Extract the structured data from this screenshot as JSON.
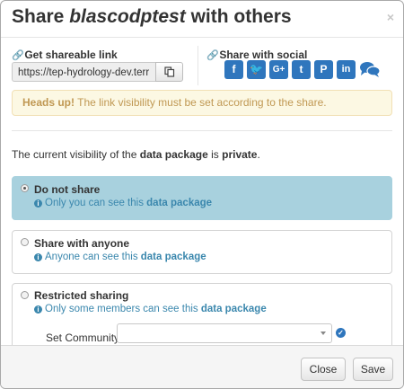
{
  "dialog": {
    "title_prefix": "Share ",
    "title_name": "blascodptest",
    "title_suffix": " with others",
    "close_glyph": "×"
  },
  "share_link": {
    "label": "Get shareable link",
    "url": "https://tep-hydrology-dev.terr",
    "copy_icon": "copy-icon"
  },
  "share_social": {
    "label": "Share with social",
    "icons": [
      "facebook-icon",
      "twitter-icon",
      "google-plus-icon",
      "tumblr-icon",
      "pinterest-icon",
      "linkedin-icon",
      "chat-icon"
    ]
  },
  "alert": {
    "strong": "Heads up!",
    "text": " The link visibility must be set according to the share."
  },
  "visibility": {
    "prefix": "The current visibility of the ",
    "object": "data package",
    "middle": " is ",
    "state": "private",
    "suffix": "."
  },
  "options": [
    {
      "title": "Do not share",
      "desc_prefix": "Only you can see this ",
      "desc_object": "data package",
      "selected": true
    },
    {
      "title": "Share with anyone",
      "desc_prefix": "Anyone can see this ",
      "desc_object": "data package",
      "selected": false
    },
    {
      "title": "Restricted sharing",
      "desc_prefix": "Only some members can see this ",
      "desc_object": "data package",
      "selected": false
    }
  ],
  "community": {
    "label": "Set Community",
    "value": ""
  },
  "footer": {
    "close_label": "Close",
    "save_label": "Save"
  },
  "colors": {
    "accent": "#2f76bd",
    "selected_bg": "#a8d1de",
    "alert_bg": "#fcf8e3",
    "alert_text": "#c09853",
    "info_text": "#3a87ad"
  }
}
